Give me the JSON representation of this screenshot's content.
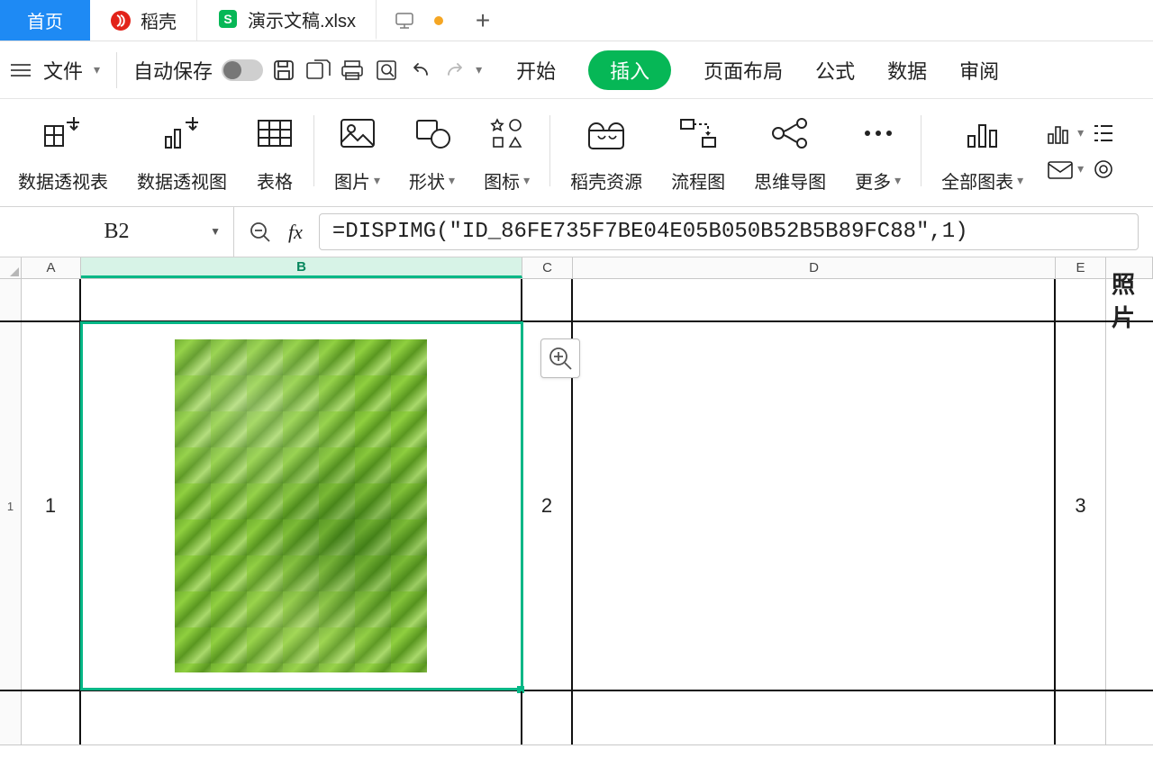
{
  "tabs": {
    "home": "首页",
    "docer": "稻壳",
    "file": "演示文稿.xlsx"
  },
  "toolbar": {
    "file": "文件",
    "autosave": "自动保存"
  },
  "menus": {
    "start": "开始",
    "insert": "插入",
    "layout": "页面布局",
    "formula": "公式",
    "data": "数据",
    "review": "审阅"
  },
  "ribbon": {
    "pivot_table": "数据透视表",
    "pivot_chart": "数据透视图",
    "table": "表格",
    "picture": "图片",
    "shape": "形状",
    "icon": "图标",
    "docer_res": "稻壳资源",
    "flow": "流程图",
    "mind": "思维导图",
    "more": "更多",
    "all_charts": "全部图表"
  },
  "cell": {
    "name": "B2",
    "fx": "fx",
    "formula": "=DISPIMG(\"ID_86FE735F7BE04E05B050B52B5B89FC88\",1)"
  },
  "cols": {
    "A": "A",
    "B": "B",
    "C": "C",
    "D": "D",
    "E": "E"
  },
  "rows": {
    "r1": "1"
  },
  "header": {
    "photo": "照片"
  },
  "data_row": {
    "c1": "1",
    "c2": "2",
    "c3": "3"
  }
}
